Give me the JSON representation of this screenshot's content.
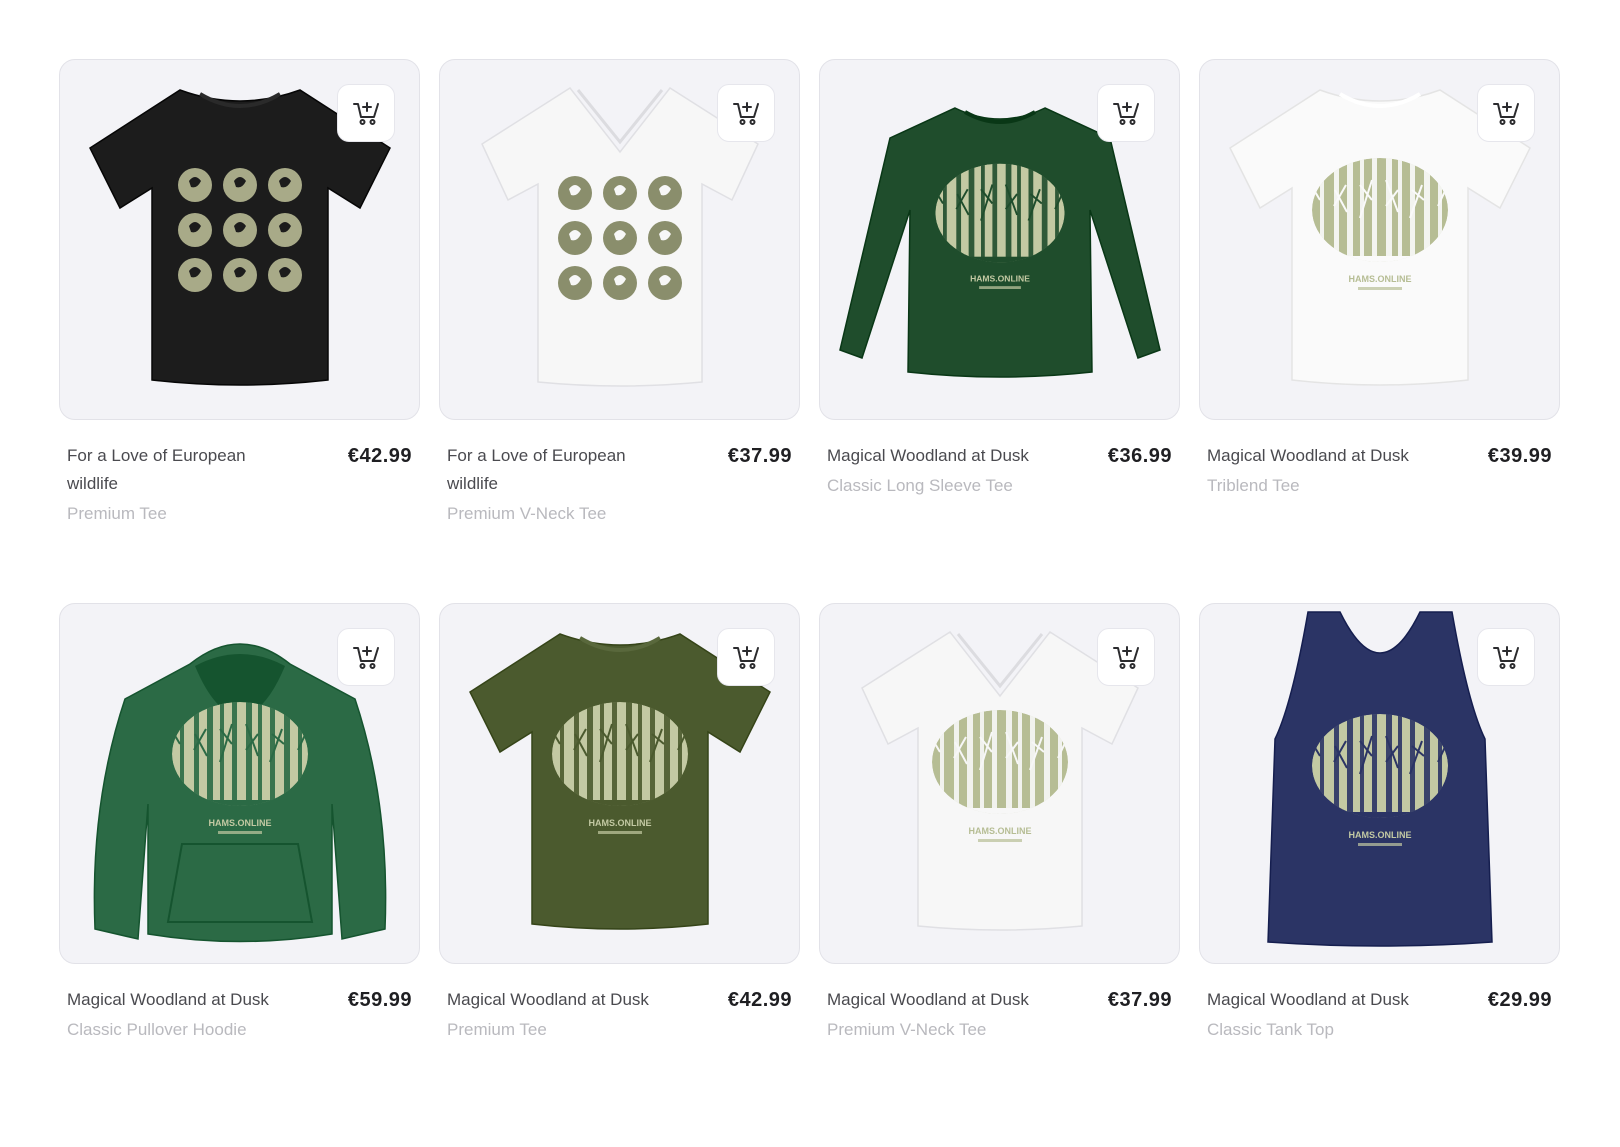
{
  "products": [
    {
      "title": "For a Love of European wildlife",
      "variant": "Premium Tee",
      "price": "€42.99",
      "garment": "tee",
      "color": "#1c1c1c",
      "print": "circles",
      "print_color": "#a8aa88"
    },
    {
      "title": "For a Love of European wildlife",
      "variant": "Premium V-Neck Tee",
      "price": "€37.99",
      "garment": "vneck",
      "color": "#f7f7f7",
      "print": "circles",
      "print_color": "#8a8e6c"
    },
    {
      "title": "Magical Woodland at Dusk",
      "variant": "Classic Long Sleeve Tee",
      "price": "€36.99",
      "garment": "longsleeve",
      "color": "#1f4d2c",
      "print": "forest",
      "print_color": "#c3c9a3",
      "print_text": "HAMS.ONLINE"
    },
    {
      "title": "Magical Woodland at Dusk",
      "variant": "Triblend Tee",
      "price": "€39.99",
      "garment": "tee",
      "color": "#fafafa",
      "print": "forest",
      "print_color": "#b6bd94",
      "print_text": "HAMS.ONLINE"
    },
    {
      "title": "Magical Woodland at Dusk",
      "variant": "Classic Pullover Hoodie",
      "price": "€59.99",
      "garment": "hoodie",
      "color": "#2b6a45",
      "print": "forest",
      "print_color": "#c3c9a3",
      "print_text": "HAMS.ONLINE"
    },
    {
      "title": "Magical Woodland at Dusk",
      "variant": "Premium Tee",
      "price": "€42.99",
      "garment": "tee",
      "color": "#4b5a2e",
      "print": "forest",
      "print_color": "#c3c9a3",
      "print_text": "HAMS.ONLINE"
    },
    {
      "title": "Magical Woodland at Dusk",
      "variant": "Premium V-Neck Tee",
      "price": "€37.99",
      "garment": "vneck",
      "color": "#f7f7f7",
      "print": "forest",
      "print_color": "#b6bd94",
      "print_text": "HAMS.ONLINE"
    },
    {
      "title": "Magical Woodland at Dusk",
      "variant": "Classic Tank Top",
      "price": "€29.99",
      "garment": "tank",
      "color": "#2b3465",
      "print": "forest",
      "print_color": "#c3c9a3",
      "print_text": "HAMS.ONLINE"
    }
  ],
  "icons": {
    "cart": "add-to-cart-icon"
  }
}
